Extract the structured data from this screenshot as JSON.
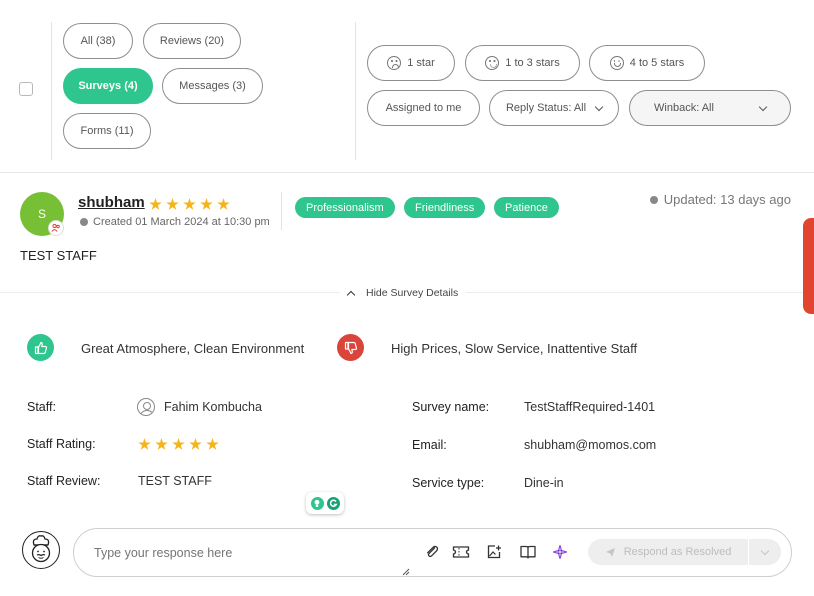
{
  "filters": {
    "type_tabs": [
      {
        "label": "All (38)"
      },
      {
        "label": "Reviews (20)"
      },
      {
        "label": "Surveys (4)"
      },
      {
        "label": "Messages (3)"
      },
      {
        "label": "Forms (11)"
      }
    ],
    "rating_filters": [
      {
        "label": "1 star"
      },
      {
        "label": "1 to 3 stars"
      },
      {
        "label": "4 to 5 stars"
      }
    ],
    "assigned_label": "Assigned to me",
    "reply_status_label": "Reply Status: All",
    "winback_label": "Winback: All"
  },
  "review": {
    "avatar_initial": "S",
    "avatar_color": "#77bf35",
    "author": "shubham",
    "rating": 5,
    "created": "Created 01 March 2024 at 10:30 pm",
    "tags": [
      "Professionalism",
      "Friendliness",
      "Patience"
    ],
    "updated": "Updated: 13 days ago",
    "text": "TEST STAFF",
    "toggle_label": "Hide Survey Details"
  },
  "survey": {
    "positive": "Great Atmosphere, Clean Environment",
    "negative": "High Prices, Slow Service, Inattentive Staff",
    "staff_label": "Staff:",
    "staff_value": "Fahim Kombucha",
    "staff_rating_label": "Staff Rating:",
    "staff_rating": 5,
    "staff_review_label": "Staff Review:",
    "staff_review_value": "TEST STAFF",
    "survey_name_label": "Survey name:",
    "survey_name_value": "TestStaffRequired-1401",
    "email_label": "Email:",
    "email_value": "shubham@momos.com",
    "service_type_label": "Service type:",
    "service_type_value": "Dine-in"
  },
  "composer": {
    "placeholder": "Type your response here",
    "resolve_label": "Respond as Resolved"
  },
  "colors": {
    "accent_green": "#2ec58f",
    "star_yellow": "#f3b51b",
    "negative_red": "#d9453a",
    "side_tab_red": "#e2452f"
  },
  "icons": [
    "paperclip-icon",
    "ticket-icon",
    "image-add-icon",
    "book-icon",
    "sparkle-icon",
    "send-icon",
    "thumbs-up-icon",
    "thumbs-down-icon",
    "clock-icon",
    "person-icon",
    "chef-avatar-icon"
  ]
}
